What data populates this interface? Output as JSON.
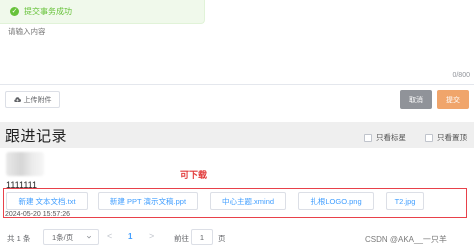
{
  "toast": {
    "message": "提交事务成功",
    "icon": "check-circle-icon",
    "color": "#67c23a"
  },
  "editor": {
    "placeholder": "请输入内容",
    "counter": "0/800"
  },
  "toolbar": {
    "upload_label": "上传附件",
    "cancel_label": "取消",
    "submit_label": "提交"
  },
  "follow": {
    "title": "跟进记录",
    "filters": [
      {
        "label": "只看标星"
      },
      {
        "label": "只看置顶"
      }
    ]
  },
  "record": {
    "content": "1111111",
    "timestamp": "2024-05-20 15:57:26",
    "attachments": [
      "新建 文本文档.txt",
      "新建 PPT 演示文稿.ppt",
      "中心主题.xmind",
      "扎根LOGO.png",
      "T2.jpg"
    ]
  },
  "annotation": "可下载",
  "pagination": {
    "total": "共 1 条",
    "page_size": "1条/页",
    "prev": "<",
    "current": "1",
    "next": ">",
    "goto_label": "前往",
    "goto_value": "1",
    "unit": "页"
  },
  "watermark": "CSDN @AKA__一只羊",
  "colors": {
    "accent": "#409eff",
    "submit": "#f0a56b",
    "cancel": "#909399",
    "highlight": "#e8414a"
  }
}
